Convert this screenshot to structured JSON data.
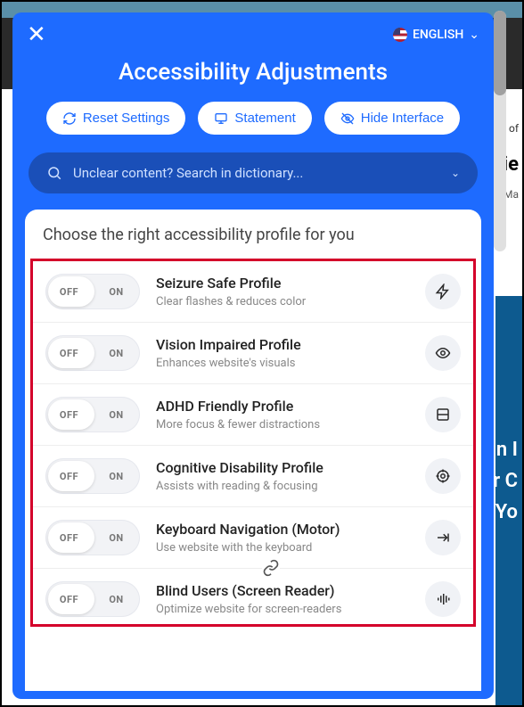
{
  "header": {
    "language_label": "ENGLISH",
    "title": "Accessibility Adjustments"
  },
  "buttons": {
    "reset": "Reset Settings",
    "statement": "Statement",
    "hide": "Hide Interface"
  },
  "search": {
    "placeholder": "Unclear content? Search in dictionary..."
  },
  "card_title": "Choose the right accessibility profile for you",
  "toggle_labels": {
    "off": "OFF",
    "on": "ON"
  },
  "profiles": [
    {
      "name": "Seizure Safe Profile",
      "desc": "Clear flashes & reduces color"
    },
    {
      "name": "Vision Impaired Profile",
      "desc": "Enhances website's visuals"
    },
    {
      "name": "ADHD Friendly Profile",
      "desc": "More focus & fewer distractions"
    },
    {
      "name": "Cognitive Disability Profile",
      "desc": "Assists with reading & focusing"
    },
    {
      "name": "Keyboard Navigation (Motor)",
      "desc": "Use website with the keyboard"
    },
    {
      "name": "Blind Users (Screen Reader)",
      "desc": "Optimize website for screen-readers"
    }
  ],
  "bg_fragments": {
    "of": "of",
    "ie": "ie",
    "ma": "n Ma",
    "side1": "n I",
    "side2": "r C",
    "side3": "Yo"
  }
}
